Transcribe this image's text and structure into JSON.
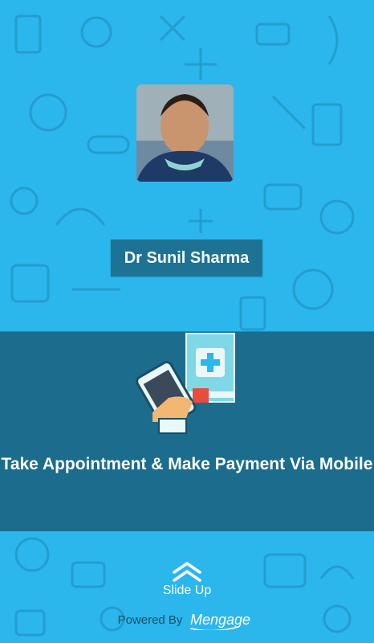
{
  "doctor": {
    "name": "Dr Sunil Sharma"
  },
  "promo": {
    "text": "Take Appointment & Make Payment Via Mobile"
  },
  "slide_up": {
    "label": "Slide Up"
  },
  "footer": {
    "powered_by": "Powered By",
    "brand": "Mengage"
  },
  "colors": {
    "background": "#2bb6ec",
    "panel": "#195f7d",
    "name_box": "#1e6f8f"
  }
}
